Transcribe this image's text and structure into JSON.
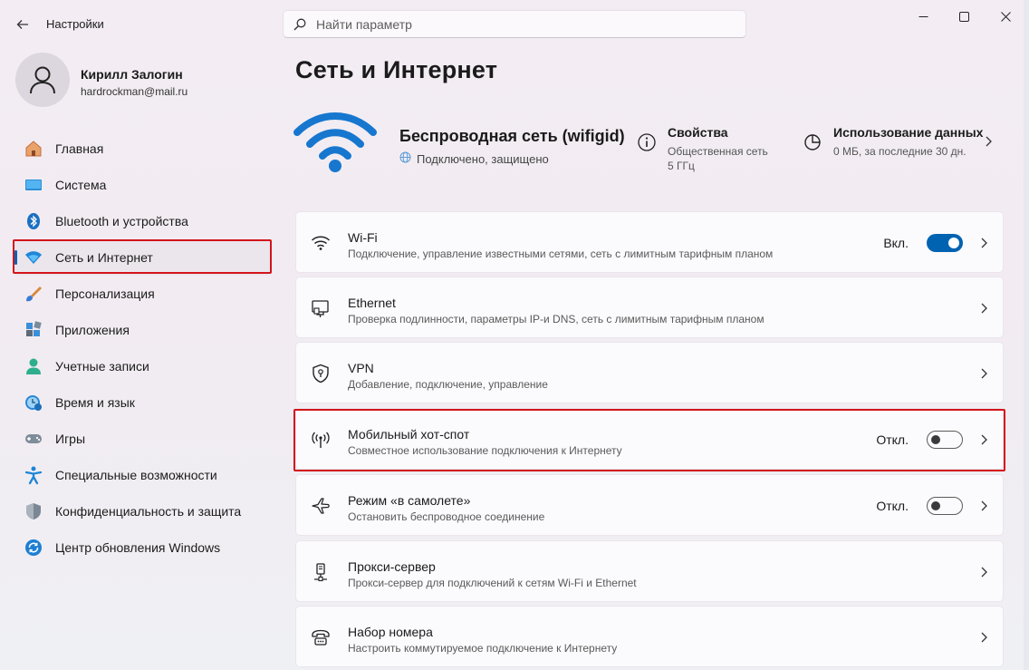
{
  "app": {
    "title": "Настройки",
    "search_placeholder": "Найти параметр"
  },
  "user": {
    "name": "Кирилл Залогин",
    "email": "hardrockman@mail.ru"
  },
  "nav": {
    "items": [
      {
        "label": "Главная",
        "icon": "home-icon"
      },
      {
        "label": "Система",
        "icon": "system-icon"
      },
      {
        "label": "Bluetooth и устройства",
        "icon": "bluetooth-icon"
      },
      {
        "label": "Сеть и Интернет",
        "icon": "network-icon",
        "active": true
      },
      {
        "label": "Персонализация",
        "icon": "brush-icon"
      },
      {
        "label": "Приложения",
        "icon": "apps-icon"
      },
      {
        "label": "Учетные записи",
        "icon": "accounts-icon"
      },
      {
        "label": "Время и язык",
        "icon": "time-language-icon"
      },
      {
        "label": "Игры",
        "icon": "gamepad-icon"
      },
      {
        "label": "Специальные возможности",
        "icon": "accessibility-icon"
      },
      {
        "label": "Конфиденциальность и защита",
        "icon": "shield-icon"
      },
      {
        "label": "Центр обновления Windows",
        "icon": "update-icon"
      }
    ]
  },
  "main": {
    "title": "Сеть и Интернет",
    "network": {
      "name": "Беспроводная сеть (wifigid)",
      "status": "Подключено, защищено"
    },
    "properties": {
      "title": "Свойства",
      "line1": "Общественная сеть",
      "line2": "5 ГГц"
    },
    "data_usage": {
      "title": "Использование данных",
      "line1": "0 МБ, за последние 30 дн."
    },
    "cards": [
      {
        "title": "Wi-Fi",
        "subtitle": "Подключение, управление известными сетями, сеть с лимитным тарифным планом",
        "state": "Вкл.",
        "toggle": "on",
        "icon": "wifi-icon"
      },
      {
        "title": "Ethernet",
        "subtitle": "Проверка подлинности, параметры IP-и DNS, сеть с лимитным тарифным планом",
        "icon": "ethernet-icon"
      },
      {
        "title": "VPN",
        "subtitle": "Добавление, подключение, управление",
        "icon": "vpn-shield-icon"
      },
      {
        "title": "Мобильный хот-спот",
        "subtitle": "Совместное использование подключения к Интернету",
        "state": "Откл.",
        "toggle": "off",
        "icon": "hotspot-icon"
      },
      {
        "title": "Режим «в самолете»",
        "subtitle": "Остановить беспроводное соединение",
        "state": "Откл.",
        "toggle": "off",
        "icon": "airplane-icon"
      },
      {
        "title": "Прокси-сервер",
        "subtitle": "Прокси-сервер для подключений к сетям Wi-Fi и Ethernet",
        "icon": "proxy-icon"
      },
      {
        "title": "Набор номера",
        "subtitle": "Настроить коммутируемое подключение к Интернету",
        "icon": "dialup-icon"
      }
    ]
  },
  "colors": {
    "accent": "#0063b1",
    "highlight_box": "#d3141c"
  }
}
